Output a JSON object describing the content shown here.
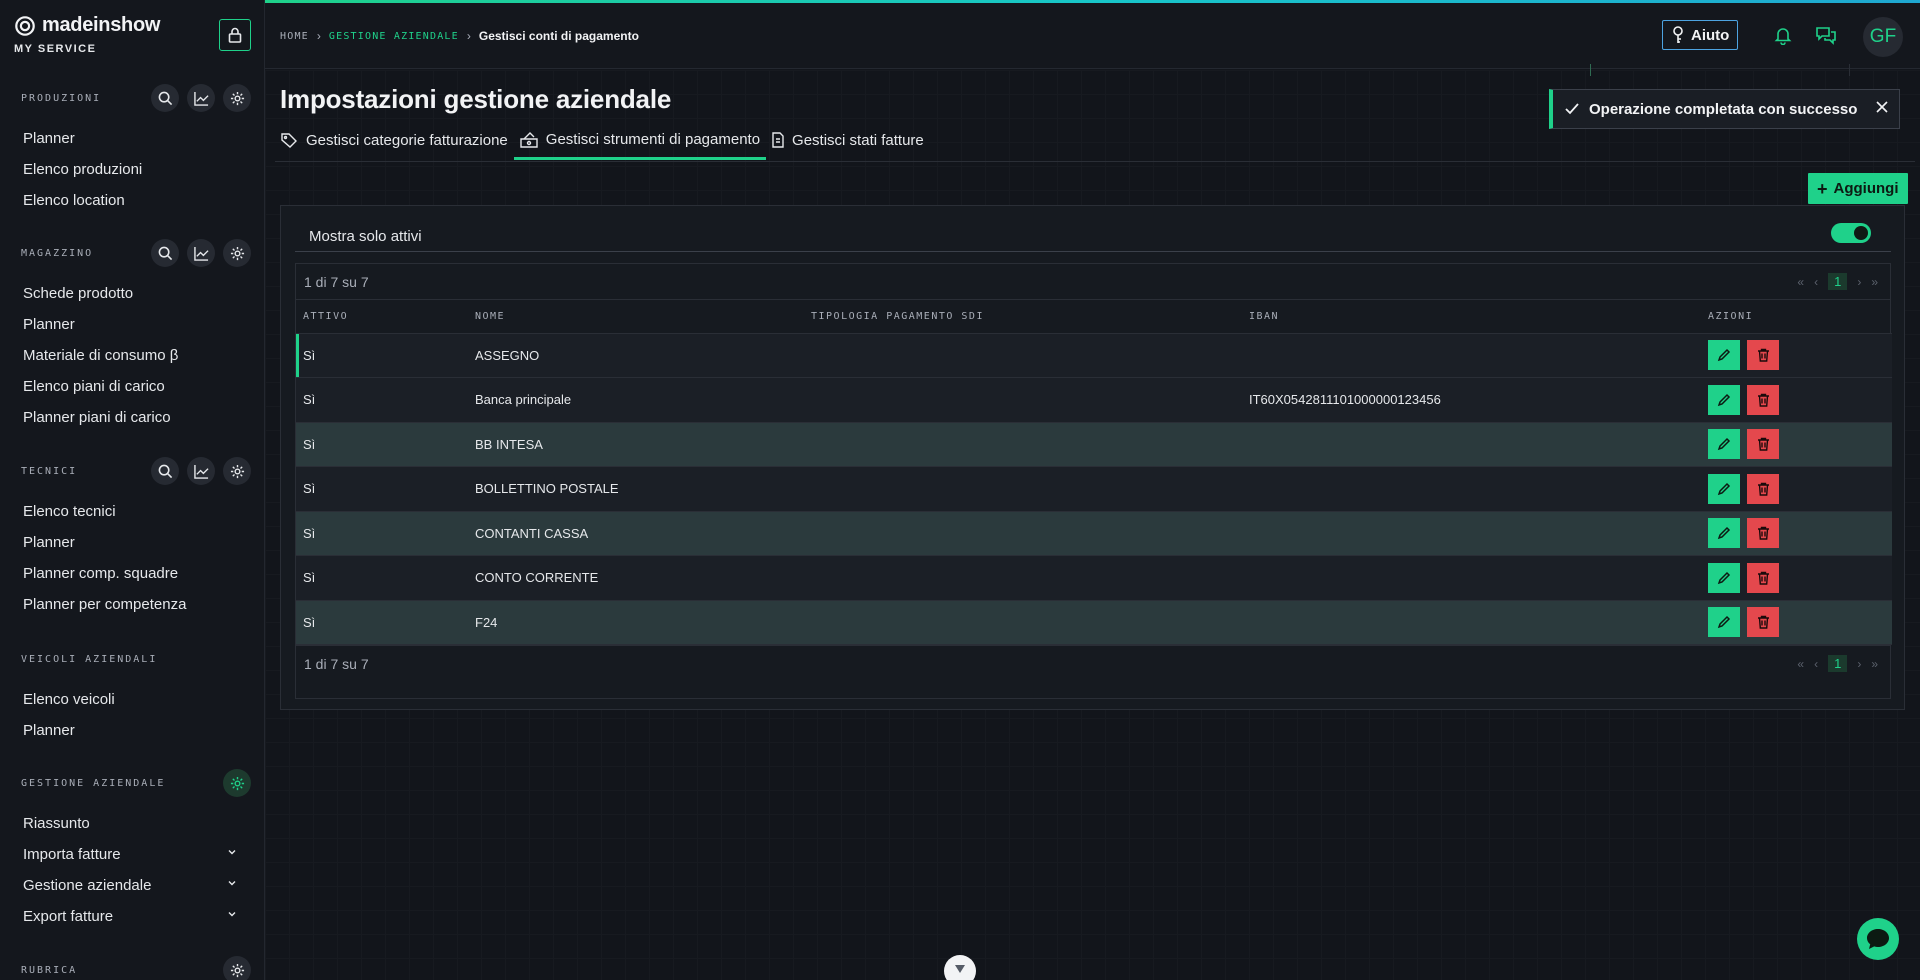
{
  "brand": {
    "name": "madeinshow",
    "subtitle": "MY SERVICE"
  },
  "sidebar": {
    "sections": [
      {
        "label": "PRODUZIONI",
        "items": [
          "Planner",
          "Elenco produzioni",
          "Elenco location"
        ]
      },
      {
        "label": "MAGAZZINO",
        "items": [
          "Schede prodotto",
          "Planner",
          "Materiale di consumo β",
          "Elenco piani di carico",
          "Planner piani di carico"
        ]
      },
      {
        "label": "TECNICI",
        "items": [
          "Elenco tecnici",
          "Planner",
          "Planner comp. squadre",
          "Planner per competenza"
        ]
      },
      {
        "label": "VEICOLI AZIENDALI",
        "items": [
          "Elenco veicoli",
          "Planner"
        ]
      },
      {
        "label": "GESTIONE AZIENDALE",
        "items": [
          "Riassunto",
          "Importa fatture",
          "Gestione aziendale",
          "Export fatture"
        ]
      },
      {
        "label": "RUBRICA",
        "items": []
      }
    ]
  },
  "breadcrumb": {
    "home": "HOME",
    "section": "GESTIONE AZIENDALE",
    "current": "Gestisci conti di pagamento"
  },
  "header": {
    "help_label": "Aiuto",
    "avatar_initials": "GF"
  },
  "page": {
    "title": "Impostazioni gestione aziendale",
    "tabs": [
      {
        "label": "Gestisci categorie fatturazione",
        "icon": "tag-icon"
      },
      {
        "label": "Gestisci strumenti di pagamento",
        "icon": "payment-icon"
      },
      {
        "label": "Gestisci stati fatture",
        "icon": "invoice-icon"
      }
    ],
    "add_label": "Aggiungi",
    "filter_label": "Mostra solo attivi",
    "pager_text": "1 di 7 su 7",
    "current_page": "1"
  },
  "table": {
    "headers": [
      "ATTIVO",
      "NOME",
      "TIPOLOGIA PAGAMENTO SDI",
      "IBAN",
      "AZIONI"
    ],
    "rows": [
      {
        "attivo": "Sì",
        "nome": "ASSEGNO",
        "tipologia": "",
        "iban": ""
      },
      {
        "attivo": "Sì",
        "nome": "Banca principale",
        "tipologia": "",
        "iban": "IT60X0542811101000000123456"
      },
      {
        "attivo": "Sì",
        "nome": "BB INTESA",
        "tipologia": "",
        "iban": ""
      },
      {
        "attivo": "Sì",
        "nome": "BOLLETTINO POSTALE",
        "tipologia": "",
        "iban": ""
      },
      {
        "attivo": "Sì",
        "nome": "CONTANTI CASSA",
        "tipologia": "",
        "iban": ""
      },
      {
        "attivo": "Sì",
        "nome": "CONTO CORRENTE",
        "tipologia": "",
        "iban": ""
      },
      {
        "attivo": "Sì",
        "nome": "F24",
        "tipologia": "",
        "iban": ""
      }
    ]
  },
  "toast": {
    "message": "Operazione completata con successo"
  },
  "colors": {
    "accent": "#1fd18a",
    "danger": "#e4484d",
    "background": "#12151b"
  }
}
